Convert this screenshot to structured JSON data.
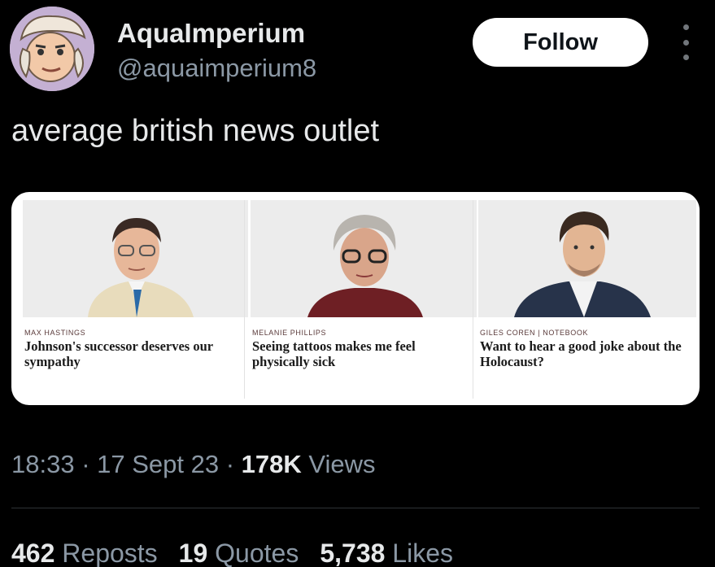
{
  "author": {
    "name": "AquaImperium",
    "handle": "@aquaimperium8",
    "follow_label": "Follow"
  },
  "tweet": {
    "text": "average british news outlet"
  },
  "articles": [
    {
      "byline": "MAX HASTINGS",
      "headline": "Johnson's successor deserves our sympathy"
    },
    {
      "byline": "MELANIE PHILLIPS",
      "headline": "Seeing tattoos makes me feel physically sick"
    },
    {
      "byline": "GILES COREN | NOTEBOOK",
      "headline": "Want to hear a good joke about the Holocaust?"
    }
  ],
  "meta": {
    "time": "18:33",
    "sep1": " · ",
    "date": "17 Sept 23",
    "sep2": " · ",
    "views_count": "178K",
    "views_label": " Views"
  },
  "stats": {
    "reposts_count": "462",
    "reposts_label": " Reposts",
    "quotes_count": "19",
    "quotes_label": " Quotes",
    "likes_count": "5,738",
    "likes_label": " Likes"
  },
  "colors": {
    "background": "#000000",
    "text_primary": "#e7e9ea",
    "text_secondary": "#8b98a5",
    "follow_bg": "#ffffff"
  }
}
